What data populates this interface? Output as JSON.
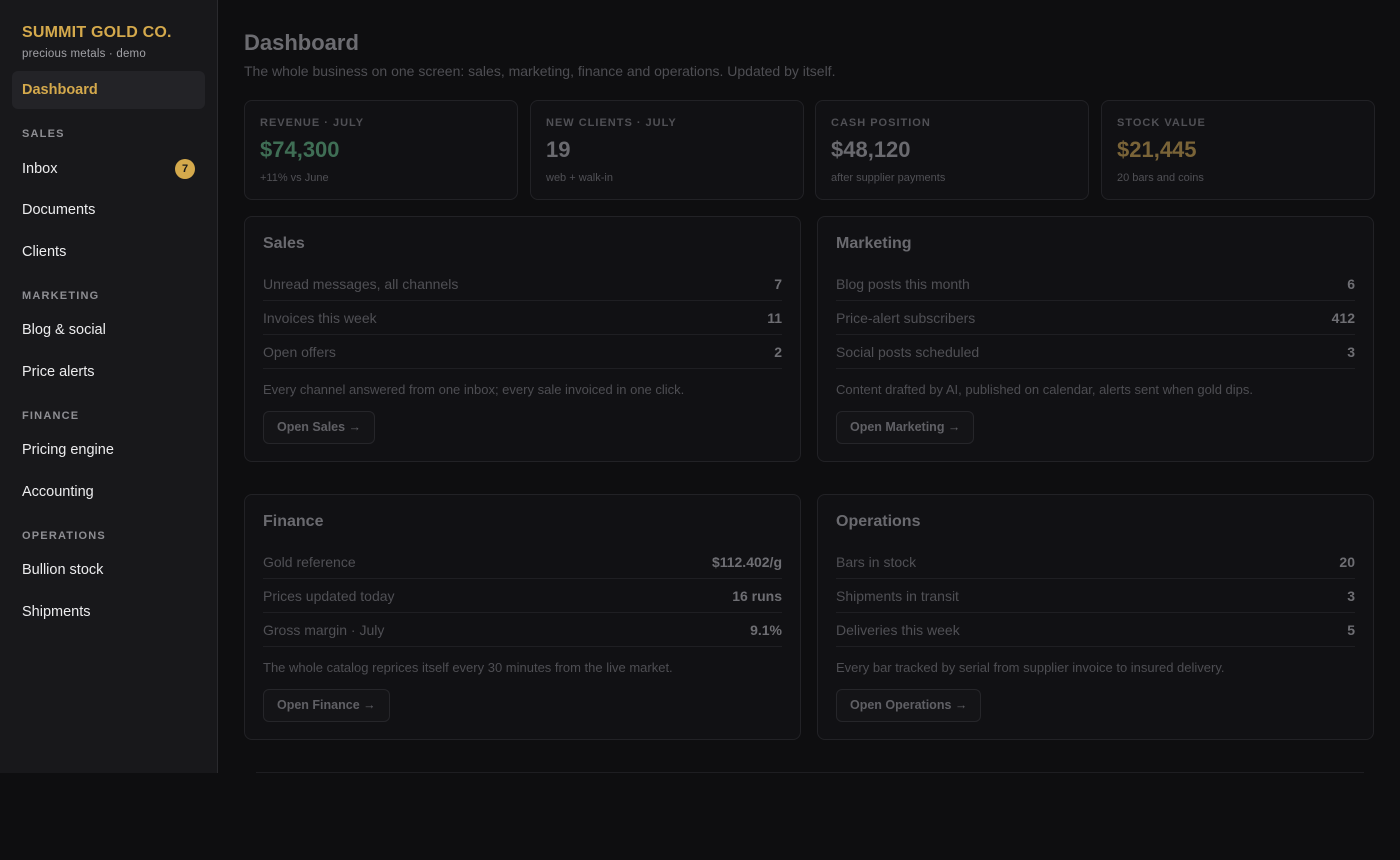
{
  "brand": {
    "name": "SUMMIT GOLD CO.",
    "subtitle": "precious metals · demo"
  },
  "nav": {
    "active": "Dashboard",
    "sections": [
      {
        "label": "SALES",
        "items": [
          {
            "label": "Inbox",
            "badge": "7"
          },
          {
            "label": "Documents"
          },
          {
            "label": "Clients"
          }
        ]
      },
      {
        "label": "MARKETING",
        "items": [
          {
            "label": "Blog & social"
          },
          {
            "label": "Price alerts"
          }
        ]
      },
      {
        "label": "FINANCE",
        "items": [
          {
            "label": "Pricing engine"
          },
          {
            "label": "Accounting"
          }
        ]
      },
      {
        "label": "OPERATIONS",
        "items": [
          {
            "label": "Bullion stock"
          },
          {
            "label": "Shipments"
          }
        ]
      }
    ]
  },
  "page": {
    "title": "Dashboard",
    "subtitle": "The whole business on one screen: sales, marketing, finance and operations. Updated by itself."
  },
  "kpis": [
    {
      "label": "REVENUE · JULY",
      "value": "$74,300",
      "note": "+11% vs June",
      "color": "#3f6e55"
    },
    {
      "label": "NEW CLIENTS · JULY",
      "value": "19",
      "note": "web + walk-in",
      "color": "#6a6a6f"
    },
    {
      "label": "CASH POSITION",
      "value": "$48,120",
      "note": "after supplier payments",
      "color": "#6a6a6f"
    },
    {
      "label": "STOCK VALUE",
      "value": "$21,445",
      "note": "20 bars and coins",
      "color": "#7a6438"
    }
  ],
  "panels": [
    {
      "title": "Sales",
      "rows": [
        {
          "label": "Unread messages, all channels",
          "value": "7"
        },
        {
          "label": "Invoices this week",
          "value": "11"
        },
        {
          "label": "Open offers",
          "value": "2"
        }
      ],
      "note": "Every channel answered from one inbox; every sale invoiced in one click.",
      "button": "Open Sales →"
    },
    {
      "title": "Marketing",
      "rows": [
        {
          "label": "Blog posts this month",
          "value": "6"
        },
        {
          "label": "Price-alert subscribers",
          "value": "412"
        },
        {
          "label": "Social posts scheduled",
          "value": "3"
        }
      ],
      "note": "Content drafted by AI, published on calendar, alerts sent when gold dips.",
      "button": "Open Marketing →"
    },
    {
      "title": "Finance",
      "rows": [
        {
          "label": "Gold reference",
          "value": "$112.402/g"
        },
        {
          "label": "Prices updated today",
          "value": "16 runs"
        },
        {
          "label": "Gross margin · July",
          "value": "9.1%"
        }
      ],
      "note": "The whole catalog reprices itself every 30 minutes from the live market.",
      "button": "Open Finance →"
    },
    {
      "title": "Operations",
      "rows": [
        {
          "label": "Bars in stock",
          "value": "20"
        },
        {
          "label": "Shipments in transit",
          "value": "3"
        },
        {
          "label": "Deliveries this week",
          "value": "5"
        }
      ],
      "note": "Every bar tracked by serial from supplier invoice to insured delivery.",
      "button": "Open Operations →"
    }
  ]
}
